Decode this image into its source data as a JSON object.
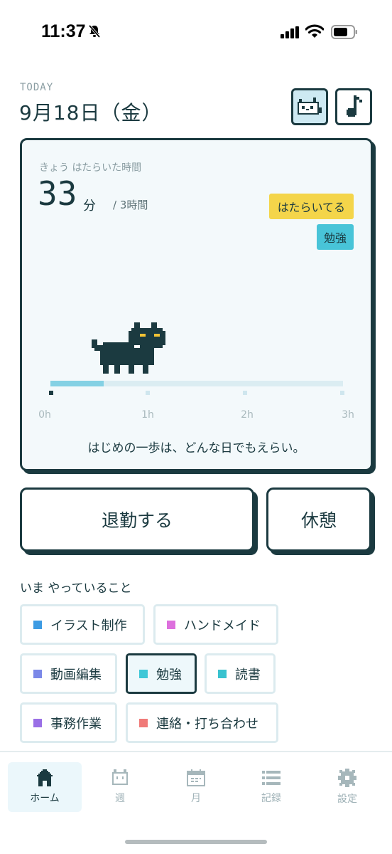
{
  "status_bar": {
    "time": "11:37"
  },
  "header": {
    "today_label": "TODAY",
    "date": "9月18日（金）",
    "cat_button_icon": "cat-face-icon",
    "music_button_icon": "music-note-icon"
  },
  "summary": {
    "worked_label": "きょう はたらいた時間",
    "minutes": "33",
    "minutes_unit": "分",
    "goal": "/ 3時間",
    "status_badge": "はたらいてる",
    "task_badge": "勉強",
    "progress_fraction": 0.183,
    "ticks": [
      "0h",
      "1h",
      "2h",
      "3h"
    ],
    "message": "はじめの一歩は、どんな日でもえらい。"
  },
  "actions": {
    "clock_out": "退勤する",
    "break": "休憩"
  },
  "activities": {
    "title": "いま やっていること",
    "items": [
      {
        "label": "イラスト制作",
        "color": "#3d9be3"
      },
      {
        "label": "ハンドメイド",
        "color": "#dd70dd"
      },
      {
        "label": "動画編集",
        "color": "#7b88e8"
      },
      {
        "label": "勉強",
        "color": "#3ec7d7",
        "active": true
      },
      {
        "label": "読書",
        "color": "#38c2cf"
      },
      {
        "label": "事務作業",
        "color": "#9a6fe6"
      },
      {
        "label": "連絡・打ち合わせ",
        "color": "#f07a78"
      }
    ]
  },
  "nav": {
    "items": [
      {
        "label": "ホーム",
        "icon": "home-icon",
        "active": true
      },
      {
        "label": "週",
        "icon": "cat-face-icon"
      },
      {
        "label": "月",
        "icon": "calendar-icon"
      },
      {
        "label": "記録",
        "icon": "list-icon"
      },
      {
        "label": "設定",
        "icon": "gear-icon"
      }
    ]
  },
  "colors": {
    "ink": "#1b3a40",
    "accent_yellow": "#f4d54a",
    "accent_cyan": "#48c4d8",
    "progress": "#84d1e4"
  }
}
